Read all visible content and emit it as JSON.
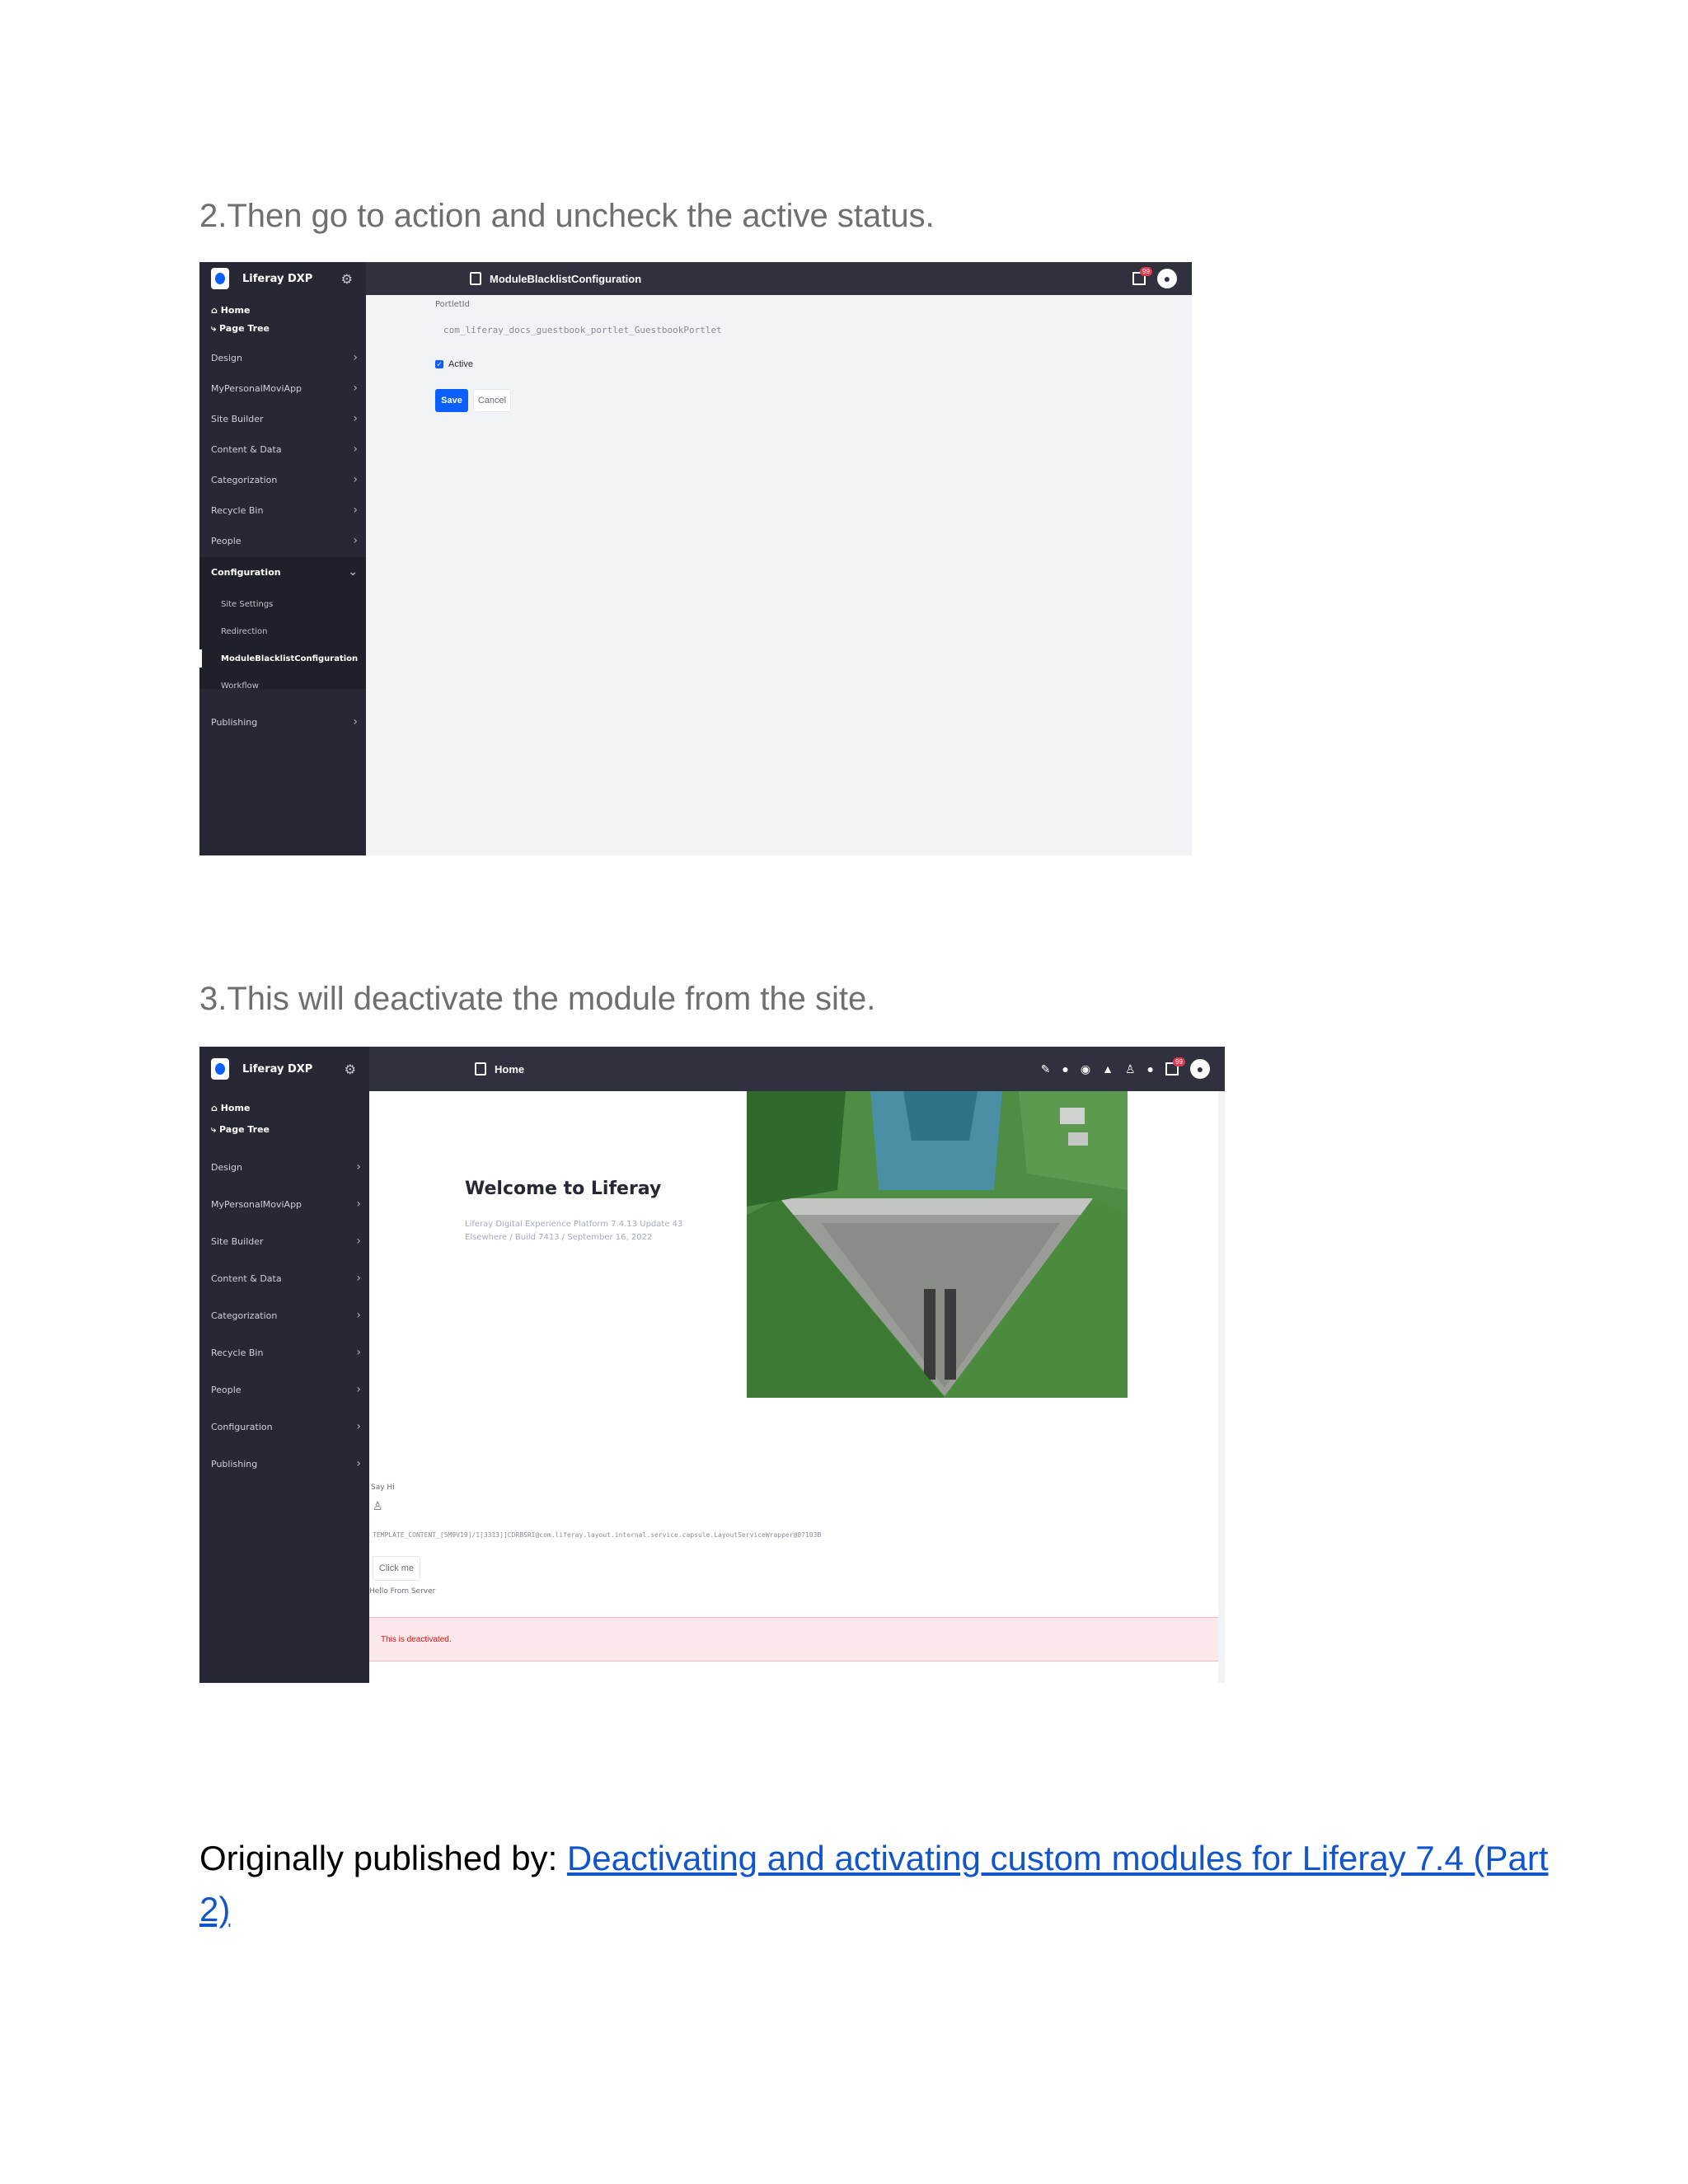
{
  "steps": {
    "step2": "2.Then go to action and uncheck the active status.",
    "step3": "3.This will deactivate the module from the site."
  },
  "shot1": {
    "sidebar": {
      "product": "Liferay DXP",
      "home": "Home",
      "page_tree": "Page Tree",
      "items": [
        "Design",
        "MyPersonalMoviApp",
        "Site Builder",
        "Content & Data",
        "Categorization",
        "Recycle Bin",
        "People"
      ],
      "configuration": "Configuration",
      "config_items": [
        "Site Settings",
        "Redirection",
        "ModuleBlacklistConfiguration",
        "Workflow"
      ],
      "publishing": "Publishing"
    },
    "topbar": {
      "title": "ModuleBlacklistConfiguration",
      "badge": "99"
    },
    "form": {
      "field_label": "PortletId",
      "field_value": "com_liferay_docs_guestbook_portlet_GuestbookPortlet",
      "checkbox_label": "Active",
      "checked": true,
      "save": "Save",
      "cancel": "Cancel"
    }
  },
  "shot2": {
    "sidebar": {
      "product": "Liferay DXP",
      "home": "Home",
      "page_tree": "Page Tree",
      "items": [
        "Design",
        "MyPersonalMoviApp",
        "Site Builder",
        "Content & Data",
        "Categorization",
        "Recycle Bin",
        "People",
        "Configuration",
        "Publishing"
      ]
    },
    "topbar": {
      "title": "Home",
      "badge": "99"
    },
    "welcome": {
      "title": "Welcome to Liferay",
      "line1": "Liferay Digital Experience Platform 7.4.13 Update 43",
      "line2": "Elsewhere / Build 7413 / September 16, 2022"
    },
    "widget": {
      "label": "Say Hi",
      "template_text": "TEMPLATE_CONTENT_[5M9V19]/1[3313]]CDRBSRI@com.liferay.layout.internal.service.capsule.LayoutServiceWrapper@87103B",
      "button": "Click me",
      "footer": "Hello From Server"
    },
    "alert": "This is deactivated."
  },
  "published": {
    "prefix": "Originally published by: ",
    "link_text": "Deactivating and activating custom modules for Liferay 7.4 (Part 2)"
  }
}
